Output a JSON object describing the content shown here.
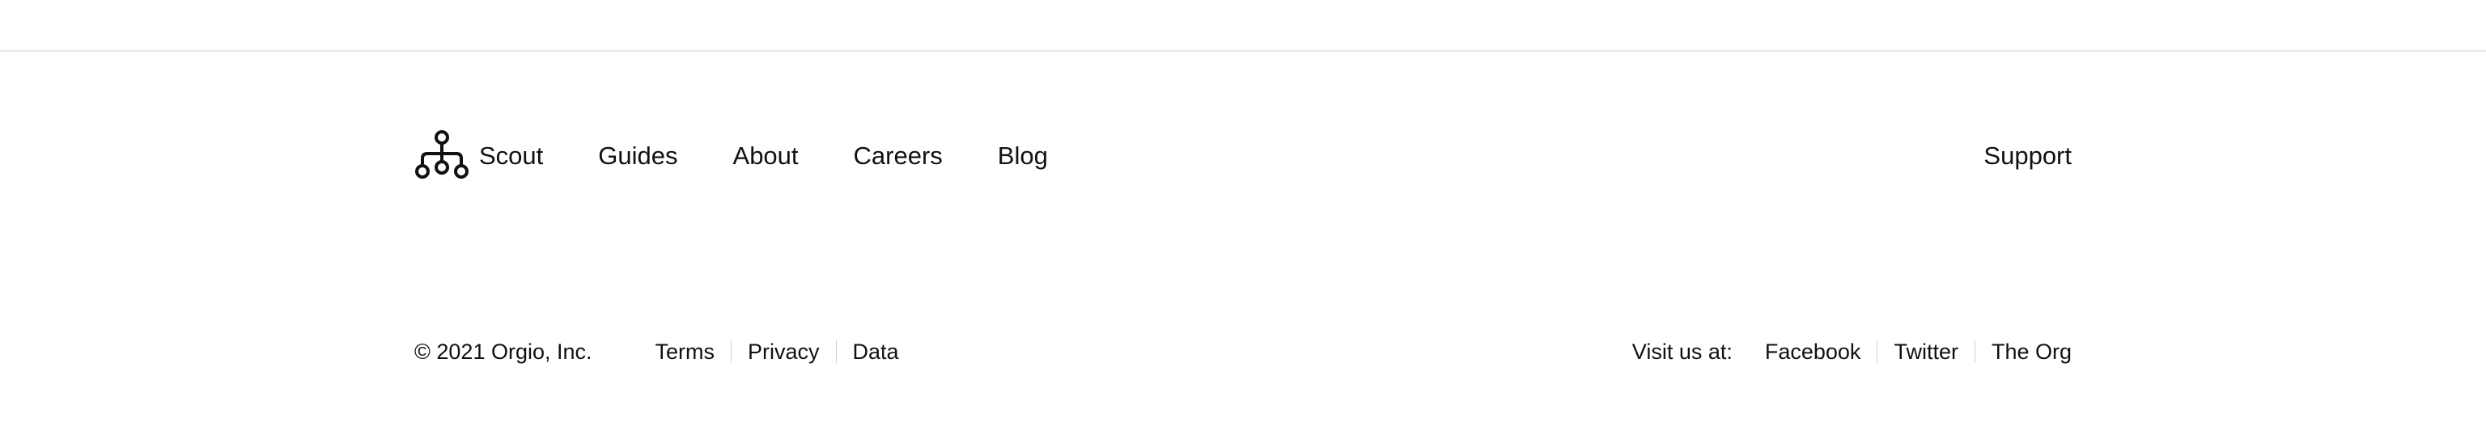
{
  "nav": {
    "logo_icon": "org-chart-icon",
    "items": [
      {
        "label": "Scout"
      },
      {
        "label": "Guides"
      },
      {
        "label": "About"
      },
      {
        "label": "Careers"
      },
      {
        "label": "Blog"
      }
    ],
    "support_label": "Support"
  },
  "bottom": {
    "copyright": "© 2021 Orgio, Inc.",
    "legal": [
      {
        "label": "Terms"
      },
      {
        "label": "Privacy"
      },
      {
        "label": "Data"
      }
    ],
    "visit_label": "Visit us at:",
    "social": [
      {
        "label": "Facebook"
      },
      {
        "label": "Twitter"
      },
      {
        "label": "The Org"
      }
    ]
  },
  "colors": {
    "text": "#111111",
    "divider": "#e9e9e9",
    "separator": "#cfcfcf",
    "background": "#ffffff"
  }
}
